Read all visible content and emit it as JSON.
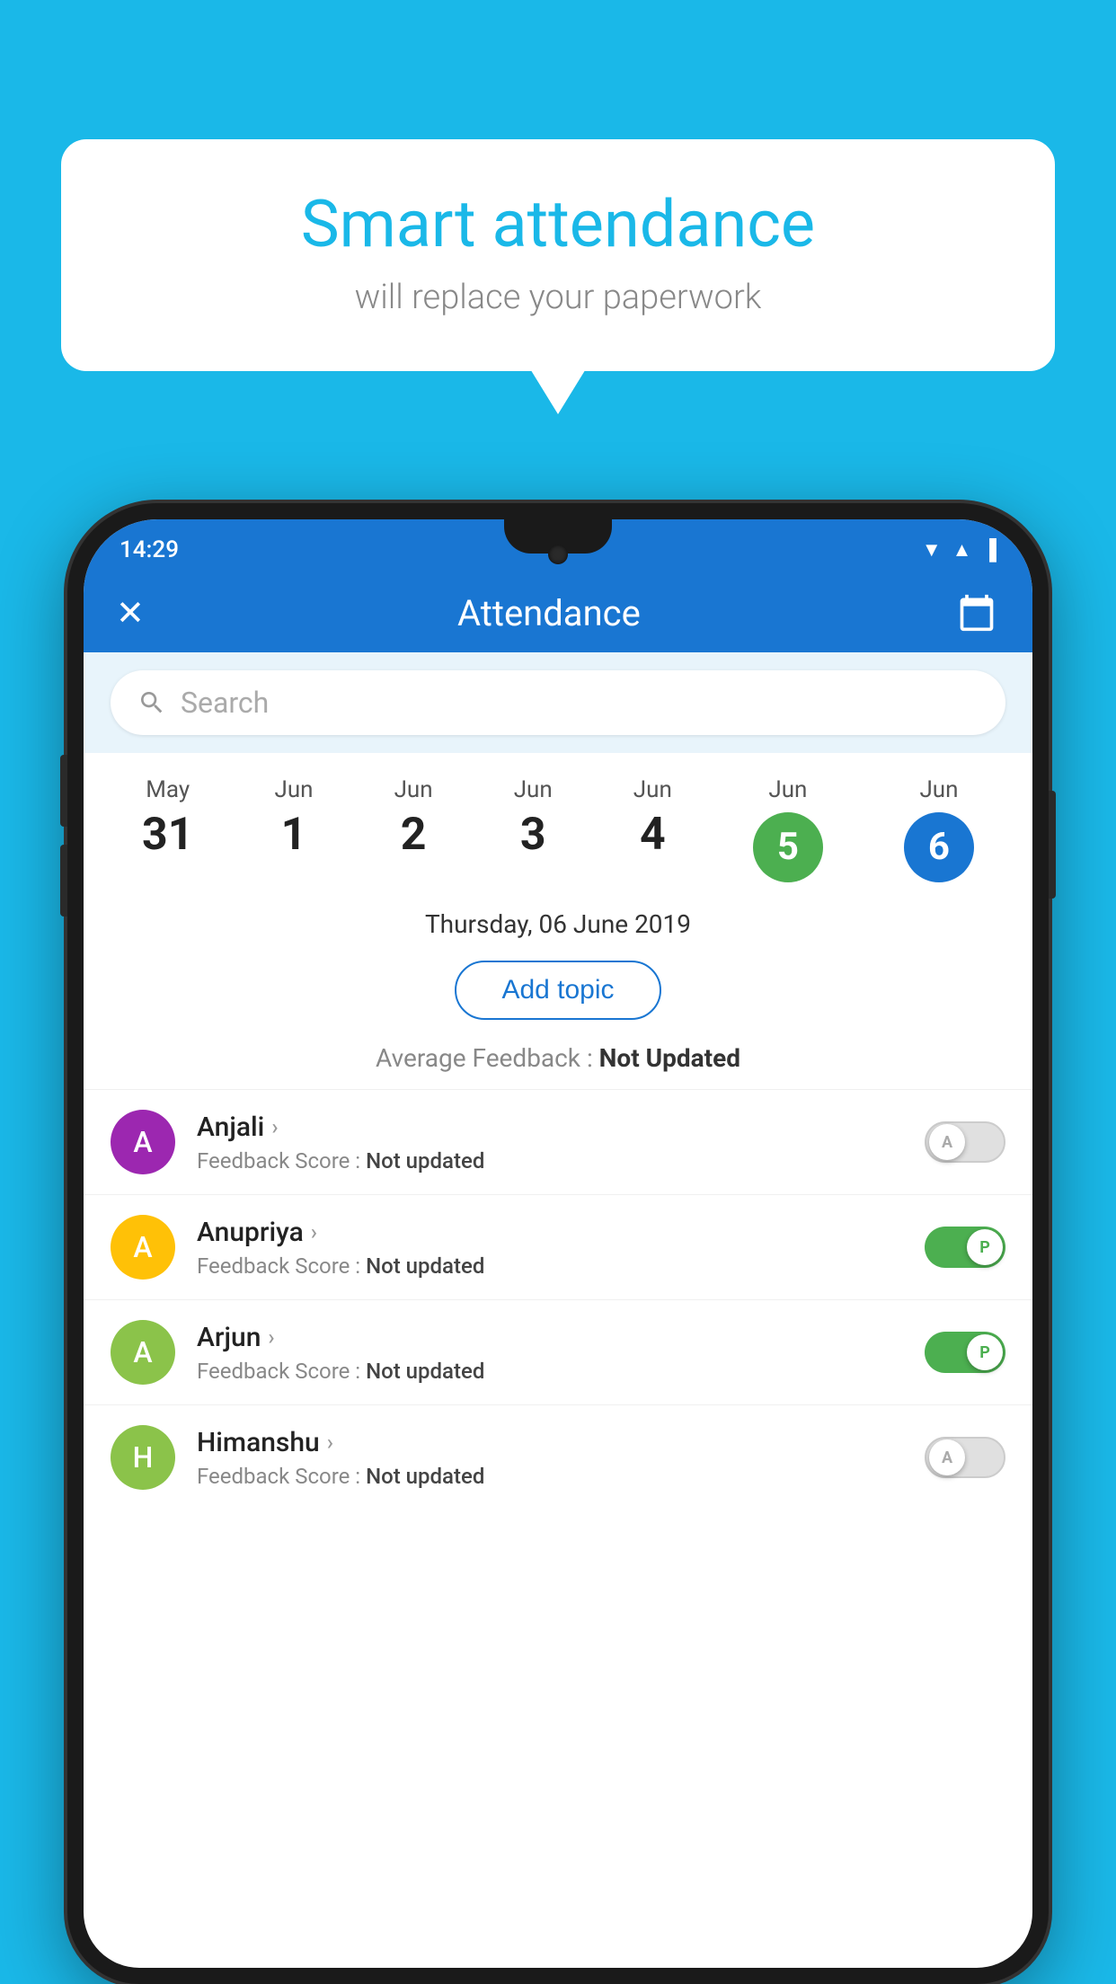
{
  "background_color": "#1ab8e8",
  "speech_bubble": {
    "title": "Smart attendance",
    "subtitle": "will replace your paperwork"
  },
  "status_bar": {
    "time": "14:29",
    "icons": [
      "wifi",
      "signal",
      "battery"
    ]
  },
  "app_bar": {
    "title": "Attendance",
    "close_label": "✕",
    "calendar_label": "📅"
  },
  "search": {
    "placeholder": "Search"
  },
  "dates": [
    {
      "month": "May",
      "day": "31",
      "state": "normal"
    },
    {
      "month": "Jun",
      "day": "1",
      "state": "normal"
    },
    {
      "month": "Jun",
      "day": "2",
      "state": "normal"
    },
    {
      "month": "Jun",
      "day": "3",
      "state": "normal"
    },
    {
      "month": "Jun",
      "day": "4",
      "state": "normal"
    },
    {
      "month": "Jun",
      "day": "5",
      "state": "today"
    },
    {
      "month": "Jun",
      "day": "6",
      "state": "selected"
    }
  ],
  "selected_date_label": "Thursday, 06 June 2019",
  "add_topic_label": "Add topic",
  "avg_feedback_label": "Average Feedback : ",
  "avg_feedback_value": "Not Updated",
  "students": [
    {
      "name": "Anjali",
      "avatar_letter": "A",
      "avatar_color": "#9c27b0",
      "feedback_label": "Feedback Score : ",
      "feedback_value": "Not updated",
      "toggle_state": "off",
      "toggle_letter": "A"
    },
    {
      "name": "Anupriya",
      "avatar_letter": "A",
      "avatar_color": "#ffc107",
      "feedback_label": "Feedback Score : ",
      "feedback_value": "Not updated",
      "toggle_state": "on",
      "toggle_letter": "P"
    },
    {
      "name": "Arjun",
      "avatar_letter": "A",
      "avatar_color": "#8bc34a",
      "feedback_label": "Feedback Score : ",
      "feedback_value": "Not updated",
      "toggle_state": "on",
      "toggle_letter": "P"
    },
    {
      "name": "Himanshu",
      "avatar_letter": "H",
      "avatar_color": "#8bc34a",
      "feedback_label": "Feedback Score : ",
      "feedback_value": "Not updated",
      "toggle_state": "off",
      "toggle_letter": "A"
    }
  ]
}
